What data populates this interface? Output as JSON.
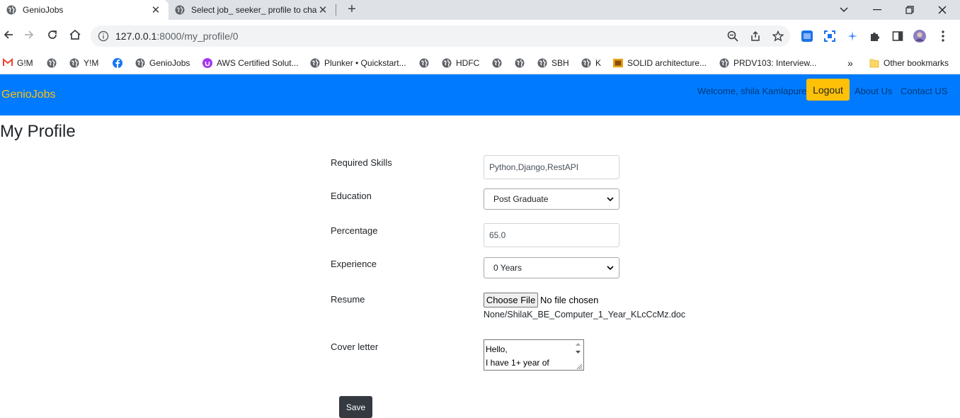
{
  "browser": {
    "tabs": [
      {
        "title": "GenioJobs",
        "active": true
      },
      {
        "title": "Select job_ seeker_ profile to cha",
        "active": false
      }
    ],
    "url_host": "127.0.0.1",
    "url_path": ":8000/my_profile/0",
    "bookmarks": [
      {
        "label": "G!M",
        "icon": "gmail-icon"
      },
      {
        "label": "",
        "icon": "globe-icon"
      },
      {
        "label": "Y!M",
        "icon": "globe-icon"
      },
      {
        "label": "",
        "icon": "facebook-icon"
      },
      {
        "label": "GenioJobs",
        "icon": "globe-icon"
      },
      {
        "label": "AWS Certified Solut...",
        "icon": "udemy-icon"
      },
      {
        "label": "Plunker • Quickstart...",
        "icon": "globe-icon"
      },
      {
        "label": "",
        "icon": "globe-icon"
      },
      {
        "label": "HDFC",
        "icon": "globe-icon"
      },
      {
        "label": "",
        "icon": "globe-icon"
      },
      {
        "label": "",
        "icon": "globe-icon"
      },
      {
        "label": "SBH",
        "icon": "globe-icon"
      },
      {
        "label": "K",
        "icon": "globe-icon"
      },
      {
        "label": "SOLID architecture...",
        "icon": "site-icon"
      },
      {
        "label": "PRDV103: Interview...",
        "icon": "globe-icon"
      }
    ],
    "more_bookmarks": "»",
    "other_bookmarks": "Other bookmarks"
  },
  "navbar": {
    "brand": "GenioJobs",
    "welcome": "Welcome, shila Kamlapure",
    "logout": "Logout",
    "about": "About Us",
    "contact": "Contact US",
    "brand_color": "#007bff",
    "accent_color": "#ffc107"
  },
  "page": {
    "title": "My Profile"
  },
  "form": {
    "skills_label": "Required Skills",
    "skills_value": "Python,Django,RestAPI",
    "education_label": "Education",
    "education_value": "Post Graduate",
    "percentage_label": "Percentage",
    "percentage_value": "65.0",
    "experience_label": "Experience",
    "experience_value": "0 Years",
    "resume_label": "Resume",
    "resume_button": "Choose File",
    "resume_status": "No file chosen",
    "resume_current": "None/ShilaK_BE_Computer_1_Year_KLcCcMz.doc",
    "cover_label": "Cover letter",
    "cover_line1": "Hello,",
    "cover_line2": "I have 1+ year of",
    "save": "Save"
  }
}
